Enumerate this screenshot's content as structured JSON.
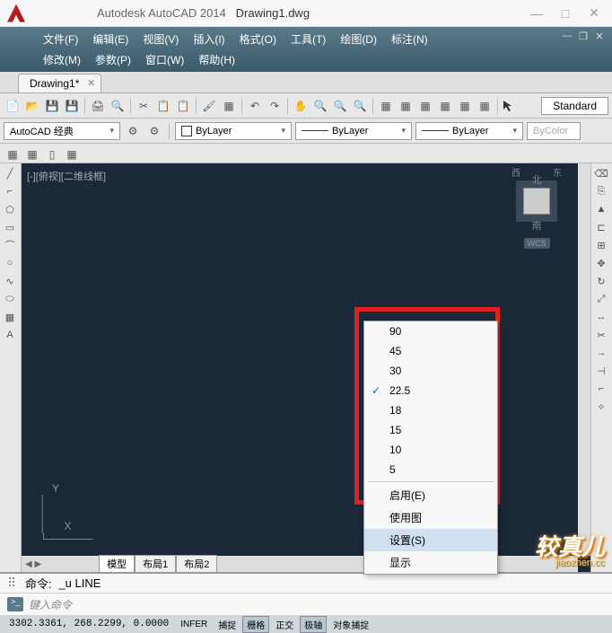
{
  "title": {
    "app": "Autodesk AutoCAD 2014",
    "doc": "Drawing1.dwg"
  },
  "menus": {
    "row1": [
      "文件(F)",
      "编辑(E)",
      "视图(V)",
      "插入(I)",
      "格式(O)",
      "工具(T)",
      "绘图(D)",
      "标注(N)"
    ],
    "row2": [
      "修改(M)",
      "参数(P)",
      "窗口(W)",
      "帮助(H)"
    ]
  },
  "doc_tab": "Drawing1*",
  "style_label": "Standard",
  "workspace": "AutoCAD 经典",
  "layer": "ByLayer",
  "linetype": "ByLayer",
  "lineweight": "ByLayer",
  "color": "ByColor",
  "viewport_label": "[-][俯视][二维线框]",
  "viewcube": {
    "n": "北",
    "s": "南",
    "e": "东",
    "w": "西",
    "wcs": "WCS"
  },
  "ucs": {
    "y": "Y",
    "x": "X"
  },
  "layout_tabs": [
    "模型",
    "布局1",
    "布局2"
  ],
  "context_menu": {
    "angles": [
      "90",
      "45",
      "30",
      "22.5",
      "18",
      "15",
      "10",
      "5"
    ],
    "checked": "22.5",
    "items": [
      "启用(E)",
      "使用图",
      "设置(S)",
      "显示"
    ],
    "highlighted": "设置(S)"
  },
  "command": {
    "prompt": "命令:",
    "history": "_u LINE",
    "placeholder": "键入命令"
  },
  "status": {
    "coords": "3302.3361, 268.2299, 0.0000",
    "buttons_left": [
      "INFER",
      "捕捉",
      "栅格",
      "正交",
      "极轴",
      "对象捕捉"
    ],
    "active": [
      "栅格",
      "极轴"
    ]
  },
  "watermark": {
    "main": "较真儿",
    "sub": "jiaozhen.cc"
  }
}
